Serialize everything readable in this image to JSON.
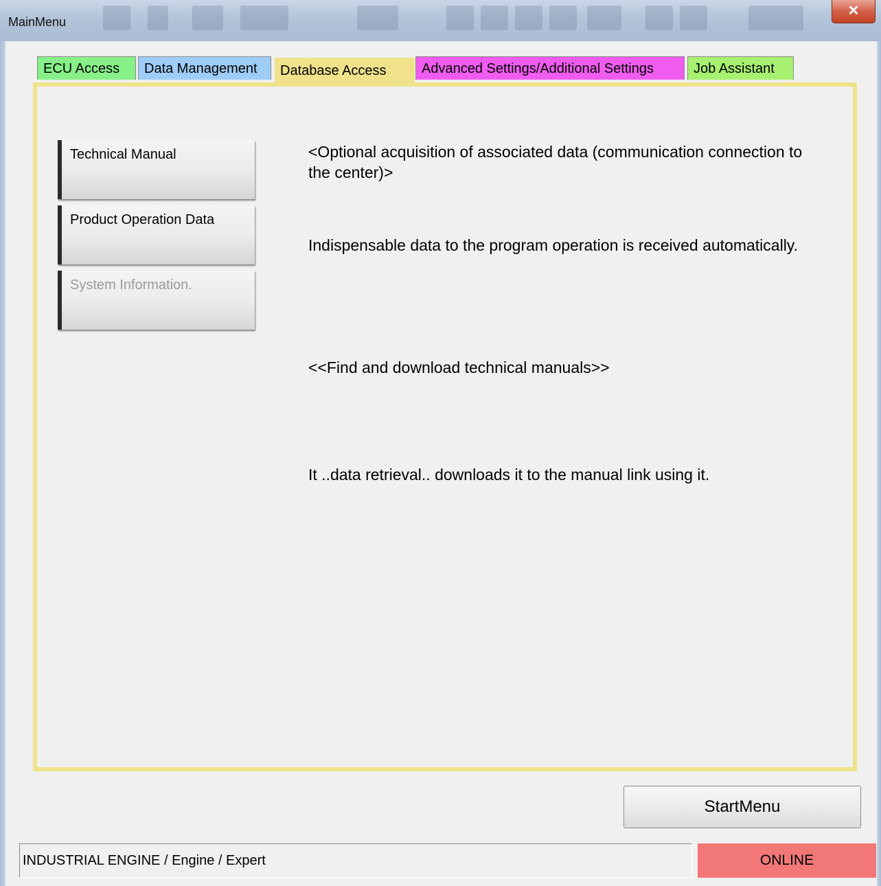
{
  "window": {
    "title": "MainMenu",
    "close_glyph": "✕"
  },
  "tabs": [
    {
      "label": "ECU Access",
      "color": "#88f088"
    },
    {
      "label": "Data Management",
      "color": "#9ecdf7"
    },
    {
      "label": "Database Access",
      "color": "#efe28a",
      "active": true
    },
    {
      "label": "Advanced Settings/Additional Settings",
      "color": "#f05cf0"
    },
    {
      "label": "Job Assistant",
      "color": "#a8f070"
    }
  ],
  "sidebar": {
    "buttons": [
      {
        "label": "Technical Manual",
        "enabled": true
      },
      {
        "label": "Product Operation Data",
        "enabled": true
      },
      {
        "label": "System Information.",
        "enabled": false
      }
    ]
  },
  "content": {
    "heading_1": "<Optional acquisition of associated data (communication connection to the center)>",
    "text_1": "Indispensable data to the program operation is received automatically.",
    "heading_2": "<<Find and download technical manuals>>",
    "text_2": "It ..data retrieval.. downloads it to the manual link using it."
  },
  "footer": {
    "start_menu_label": "StartMenu",
    "status_path": "INDUSTRIAL ENGINE / Engine / Expert",
    "connection_status": "ONLINE",
    "connection_color": "#f27878"
  }
}
